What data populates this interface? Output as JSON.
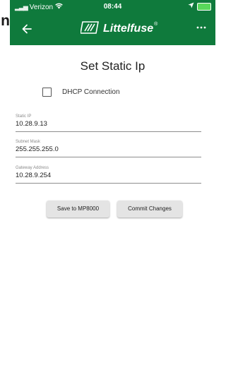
{
  "status_bar": {
    "carrier": "Verizon",
    "time": "08:44"
  },
  "app_bar": {
    "back_icon": "arrow-left-icon",
    "brand_name": "Littelfuse",
    "brand_trademark": "®",
    "menu_icon": "more-horizontal-icon",
    "background_color": "#0f7a3c"
  },
  "edge_fragment": "n",
  "page": {
    "title": "Set Static Ip",
    "dhcp": {
      "label": "DHCP Connection",
      "checked": false
    },
    "fields": [
      {
        "label": "Static IP",
        "value": "10.28.9.13"
      },
      {
        "label": "Subnet Mask",
        "value": "255.255.255.0"
      },
      {
        "label": "Gateway Address",
        "value": "10.28.9.254"
      }
    ],
    "buttons": {
      "save": "Save to MP8000",
      "commit": "Commit Changes"
    }
  }
}
